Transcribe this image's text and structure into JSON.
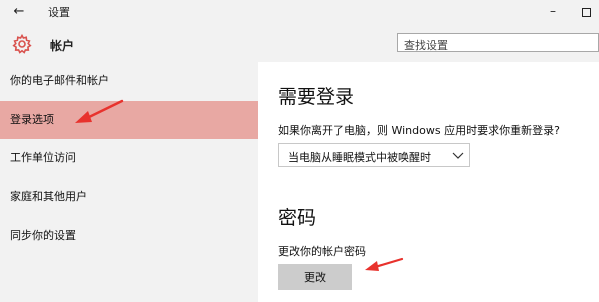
{
  "window": {
    "back_glyph": "←",
    "title": "设置",
    "minimize_glyph": "–"
  },
  "header": {
    "page_title": "帐户",
    "page_icon": "gear-icon",
    "search_placeholder": "查找设置"
  },
  "sidebar": {
    "items": [
      {
        "label": "你的电子邮件和帐户",
        "selected": false
      },
      {
        "label": "登录选项",
        "selected": true
      },
      {
        "label": "工作单位访问",
        "selected": false
      },
      {
        "label": "家庭和其他用户",
        "selected": false
      },
      {
        "label": "同步你的设置",
        "selected": false
      }
    ]
  },
  "signin_required": {
    "heading": "需要登录",
    "description": "如果你离开了电脑，则 Windows 应用时要求你重新登录?",
    "dropdown_value": "当电脑从睡眠模式中被唤醒时"
  },
  "password": {
    "heading": "密码",
    "description": "更改你的帐户密码",
    "button_label": "更改"
  },
  "colors": {
    "selected_item": "#e8a8a3",
    "gear": "#d9534f",
    "arrow": "#e8322d"
  }
}
